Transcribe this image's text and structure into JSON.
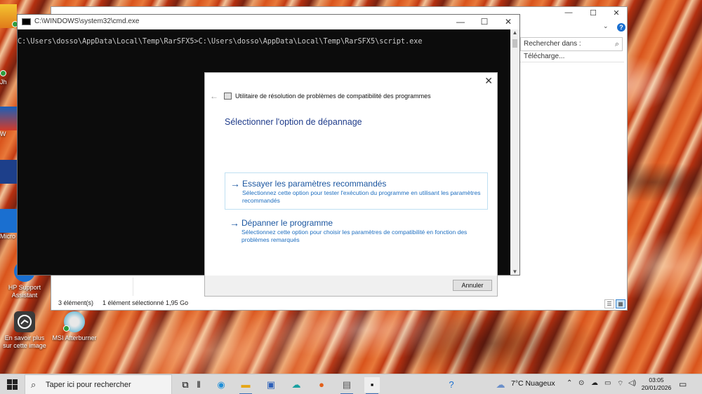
{
  "cmd": {
    "title": "C:\\WINDOWS\\system32\\cmd.exe",
    "console_line": "C:\\Users\\dosso\\AppData\\Local\\Temp\\RarSFX5>C:\\Users\\dosso\\AppData\\Local\\Temp\\RarSFX5\\script.exe",
    "minimize": "—",
    "maximize": "☐",
    "close": "✕"
  },
  "explorer": {
    "search_placeholder": "Rechercher dans : Télécharge...",
    "status_items": "3 élément(s)",
    "status_selected": "1 élément sélectionné  1,95 Go",
    "help": "?",
    "minimize": "—",
    "maximize": "☐",
    "close": "✕"
  },
  "dialog": {
    "header_title": "Utilitaire de résolution de problèmes de compatibilité des programmes",
    "heading": "Sélectionner l'option de dépannage",
    "options": [
      {
        "title": "Essayer les paramètres recommandés",
        "description": "Sélectionnez cette option pour tester l'exécution du programme en utilisant les paramètres recommandés"
      },
      {
        "title": "Dépanner le programme",
        "description": "Sélectionnez cette option pour choisir les paramètres de compatibilité en fonction des problèmes remarqués"
      }
    ],
    "cancel_label": "Annuler",
    "close": "✕",
    "back": "←"
  },
  "desktop": {
    "icons": [
      {
        "label": "HP Support Assistant"
      },
      {
        "label": "En savoir plus sur cette image"
      },
      {
        "label": "MSI Afterburner"
      }
    ],
    "left_fragments": [
      "Jh",
      "W",
      "Micro"
    ]
  },
  "taskbar": {
    "search_placeholder": "Taper ici pour rechercher",
    "weather": "7°C  Nuageux",
    "time": "03:05",
    "date": "20/01/2026"
  },
  "colors": {
    "accent_link": "#1b56a0",
    "heading_blue": "#1e3b8a",
    "console_bg": "#0c0c0c"
  }
}
